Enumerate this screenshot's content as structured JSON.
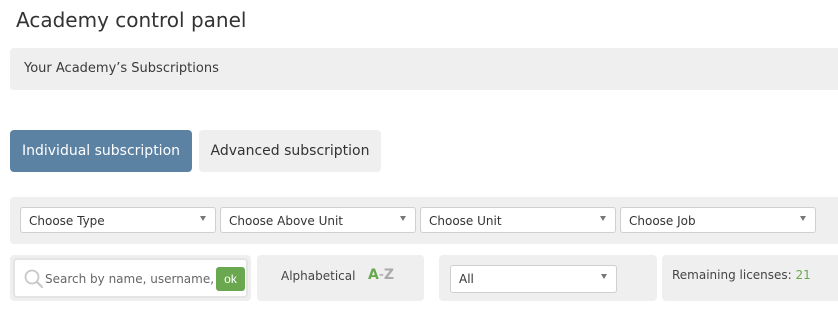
{
  "page": {
    "title": "Academy control panel"
  },
  "section": {
    "title": "Your Academy’s Subscriptions"
  },
  "tabs": [
    {
      "label": "Individual subscription",
      "active": true
    },
    {
      "label": "Advanced subscription",
      "active": false
    }
  ],
  "filters": {
    "type": {
      "selected": "Choose Type"
    },
    "above_unit": {
      "selected": "Choose Above Unit"
    },
    "unit": {
      "selected": "Choose Unit"
    },
    "job": {
      "selected": "Choose Job"
    }
  },
  "search": {
    "placeholder": "Search by name, username, e",
    "value": "",
    "ok_label": "ok"
  },
  "sort": {
    "label": "Alphabetical",
    "az_a": "A",
    "az_dash": "-",
    "az_z": "Z"
  },
  "status_filter": {
    "selected": "All"
  },
  "licenses": {
    "label": "Remaining licenses:",
    "count": "21"
  },
  "colors": {
    "primary_tab": "#5b81a3",
    "accent_green": "#6aa84f",
    "panel_bg": "#efefef"
  },
  "icons": {
    "search": "search-icon",
    "caret": "chevron-down-icon"
  }
}
